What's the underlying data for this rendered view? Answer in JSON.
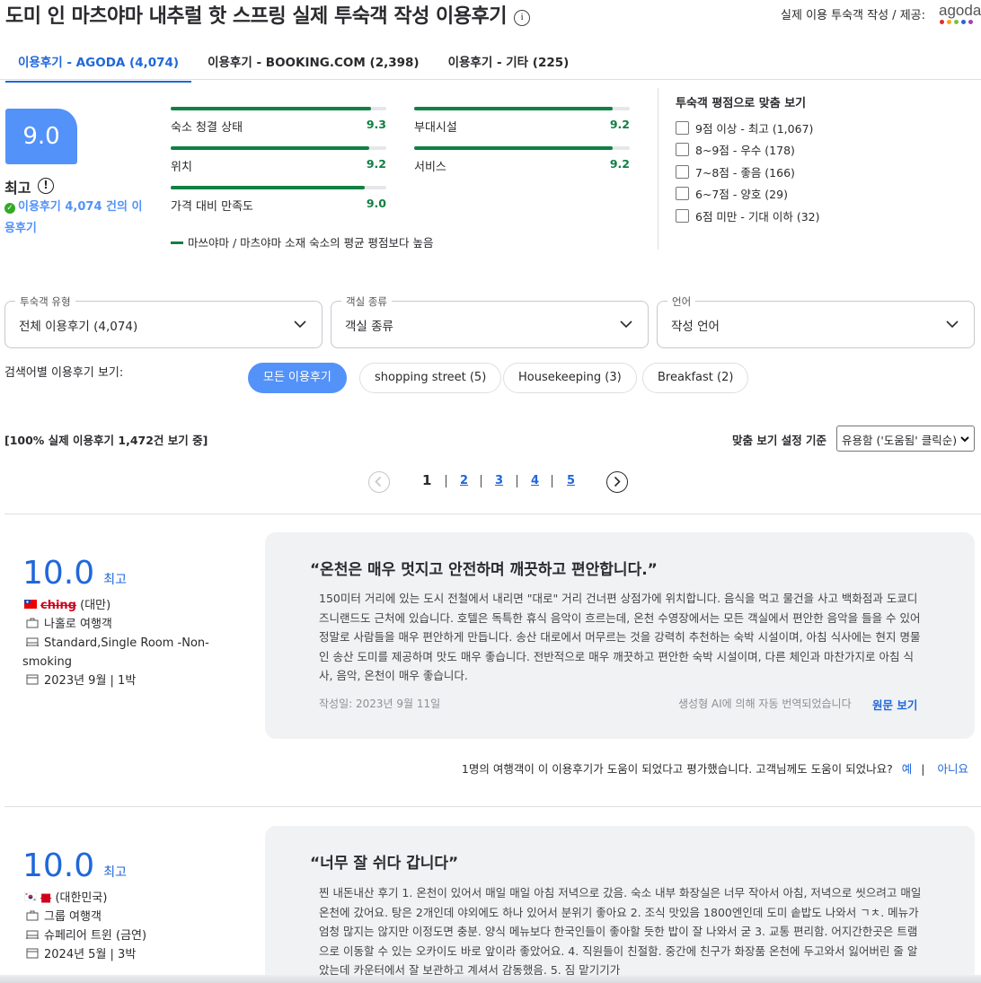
{
  "header": {
    "title": "도미 인 마츠야마 내추럴 핫 스프링 실제 투숙객 작성 이용후기",
    "info_icon": "ⓘ",
    "provider_text": "실제 이용 투숙객 작성 / 제공:",
    "provider_logo_text": "agoda",
    "logo_dot_colors": [
      "#e12d2d",
      "#f8a41e",
      "#7dc242",
      "#2067da",
      "#a042ad"
    ]
  },
  "tabs": [
    {
      "label": "이용후기 - AGODA (4,074)",
      "active": true
    },
    {
      "label": "이용후기 - BOOKING.COM (2,398)",
      "active": false
    },
    {
      "label": "이용후기 - 기타 (225)",
      "active": false
    }
  ],
  "score": {
    "value": "9.0",
    "word": "최고",
    "verified_text": "이용후기 4,074 건의 이용후기"
  },
  "subscores": [
    {
      "label": "숙소 청결 상태",
      "value": "9.3",
      "fraction": 0.93
    },
    {
      "label": "부대시설",
      "value": "9.2",
      "fraction": 0.92
    },
    {
      "label": "위치",
      "value": "9.2",
      "fraction": 0.92
    },
    {
      "label": "서비스",
      "value": "9.2",
      "fraction": 0.92
    },
    {
      "label": "가격 대비 만족도",
      "value": "9.0",
      "fraction": 0.9
    }
  ],
  "legend_note": "마쓰야마 / 마츠야마 소재 숙소의 평균 평점보다 높음",
  "score_filters": {
    "title": "투숙객 평점으로 맞춤 보기",
    "options": [
      "9점 이상 - 최고 (1,067)",
      "8~9점 - 우수 (178)",
      "7~8점 - 좋음 (166)",
      "6~7점 - 양호 (29)",
      "6점 미만 - 기대 이하 (32)"
    ]
  },
  "dropdowns": [
    {
      "label": "투숙객 유형",
      "value": "전체 이용후기 (4,074)"
    },
    {
      "label": "객실 종류",
      "value": "객실 종류"
    },
    {
      "label": "언어",
      "value": "작성 언어"
    }
  ],
  "keyword_search": {
    "label": "검색어별 이용후기 보기:",
    "chips": [
      "모든 이용후기",
      "shopping street (5)",
      "Housekeeping (3)",
      "Breakfast (2)"
    ]
  },
  "listing": {
    "showing_text": "[100% 실제 이용후기 1,472건 보기 중]",
    "sort_label": "맞춤 보기 설정 기준",
    "sort_value": "유용함 ('도움됨' 클릭순)"
  },
  "pagination": {
    "pages": [
      "1",
      "2",
      "3",
      "4",
      "5"
    ],
    "current": "1"
  },
  "reviews": [
    {
      "score": "10.0",
      "score_word": "최고",
      "reviewer_name": "ching",
      "country": "(대만)",
      "traveler_type": "나홀로 여행객",
      "room": "Standard,Single Room -Non-smoking",
      "stay": "2023년 9월 | 1박",
      "title": "“온천은 매우 멋지고 안전하며 깨끗하고 편안합니다.”",
      "body": "150미터 거리에 있는 도시 전철에서 내리면 \"대로\" 거리 건너편 상점가에 위치합니다. 음식을 먹고 물건을 사고 백화점과 도쿄디즈니랜드도 근처에 있습니다. 호텔은 독특한 휴식 음악이 흐르는데, 온천 수영장에서는 모든 객실에서 편안한 음악을 들을 수 있어 정말로 사람들을 매우 편안하게 만듭니다. 송산 대로에서 머무르는 것을 강력히 추천하는 숙박 시설이며, 아침 식사에는 현지 명물인 송산 도미를 제공하며 맛도 매우 좋습니다. 전반적으로 매우 깨끗하고 편안한 숙박 시설이며, 다른 체인과 마찬가지로 아침 식사, 음악, 온천이 매우 좋습니다.",
      "date": "작성일: 2023년 9월 11일",
      "ai_note": "생성형 AI에 의해 자동 번역되었습니다",
      "original_link": "원문 보기",
      "helpful_text": "1명의 여행객이 이 이용후기가 도움이 되었다고 평가했습니다. 고객님께도 도움이 되었나요?",
      "yes": "예",
      "no": "아니요"
    },
    {
      "score": "10.0",
      "score_word": "최고",
      "reviewer_name": "",
      "country": "(대한민국)",
      "traveler_type": "그룹 여행객",
      "room": "슈페리어 트윈 (금연)",
      "stay": "2024년 5월 | 3박",
      "title": "“너무 잘 쉬다 갑니다”",
      "body": "찐 내돈내산 후기 1. 온천이 있어서 매일 매일 아침 저녁으로 갔음. 숙소 내부 화장실은 너무 작아서 아침, 저녁으로 씻으려고 매일 온천에 갔어요. 탕은 2개인데 야외에도 하나 있어서 분위기 좋아요 2. 조식 맛있음 1800엔인데 도미 솥밥도 나와서 ㄱㅊ. 메뉴가 엄청 많지는 않지만 이정도면 충분. 양식 메뉴보다 한국인들이 좋아할 듯한 밥이 잘 나와서 굳 3. 교통 편리함. 어지간한곳은 트램으로 이동할 수 있는 오카이도 바로 앞이라 좋았어요. 4. 직원들이 친절함. 중간에 친구가 화장품 온천에 두고와서 잃어버린 줄 알았는데 카운터에서 잘 보관하고 계셔서 감동했음. 5. 짐 맡기기가"
    }
  ]
}
